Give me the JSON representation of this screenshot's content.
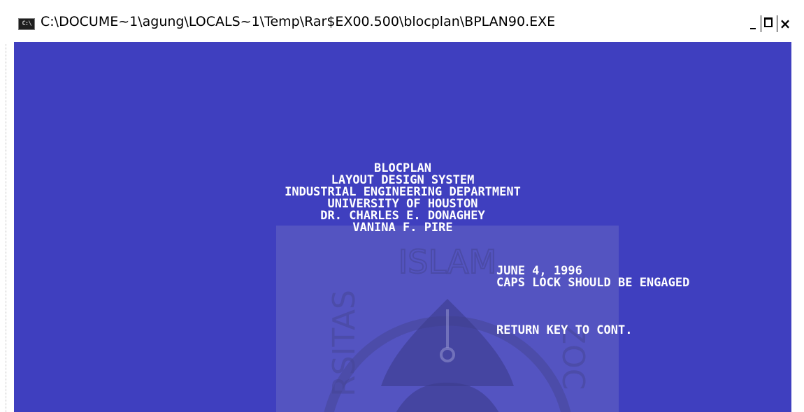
{
  "window": {
    "title": "C:\\DOCUME~1\\agung\\LOCALS~1\\Temp\\Rar$EX00.500\\blocplan\\BPLAN90.EXE",
    "icon": "console-app-icon",
    "icon_label": "C:\\",
    "controls": {
      "minimize": "minimize-icon",
      "maximize": "maximize-icon",
      "close_label": "×"
    }
  },
  "console": {
    "background_color": "#3f3fbf",
    "text_color": "#ffffff",
    "header_lines": [
      "BLOCPLAN",
      "LAYOUT DESIGN SYSTEM",
      "INDUSTRIAL ENGINEERING DEPARTMENT",
      "UNIVERSITY OF HOUSTON",
      "DR. CHARLES E. DONAGHEY",
      "VANINA F. PIRE"
    ],
    "date": "JUNE 4, 1996",
    "caps_notice": "CAPS LOCK SHOULD BE ENGAGED",
    "continue_prompt": "RETURN KEY TO CONT."
  },
  "watermark": {
    "text": "ISLAM",
    "side_left": "RSITAS",
    "side_right": "ZOC"
  }
}
